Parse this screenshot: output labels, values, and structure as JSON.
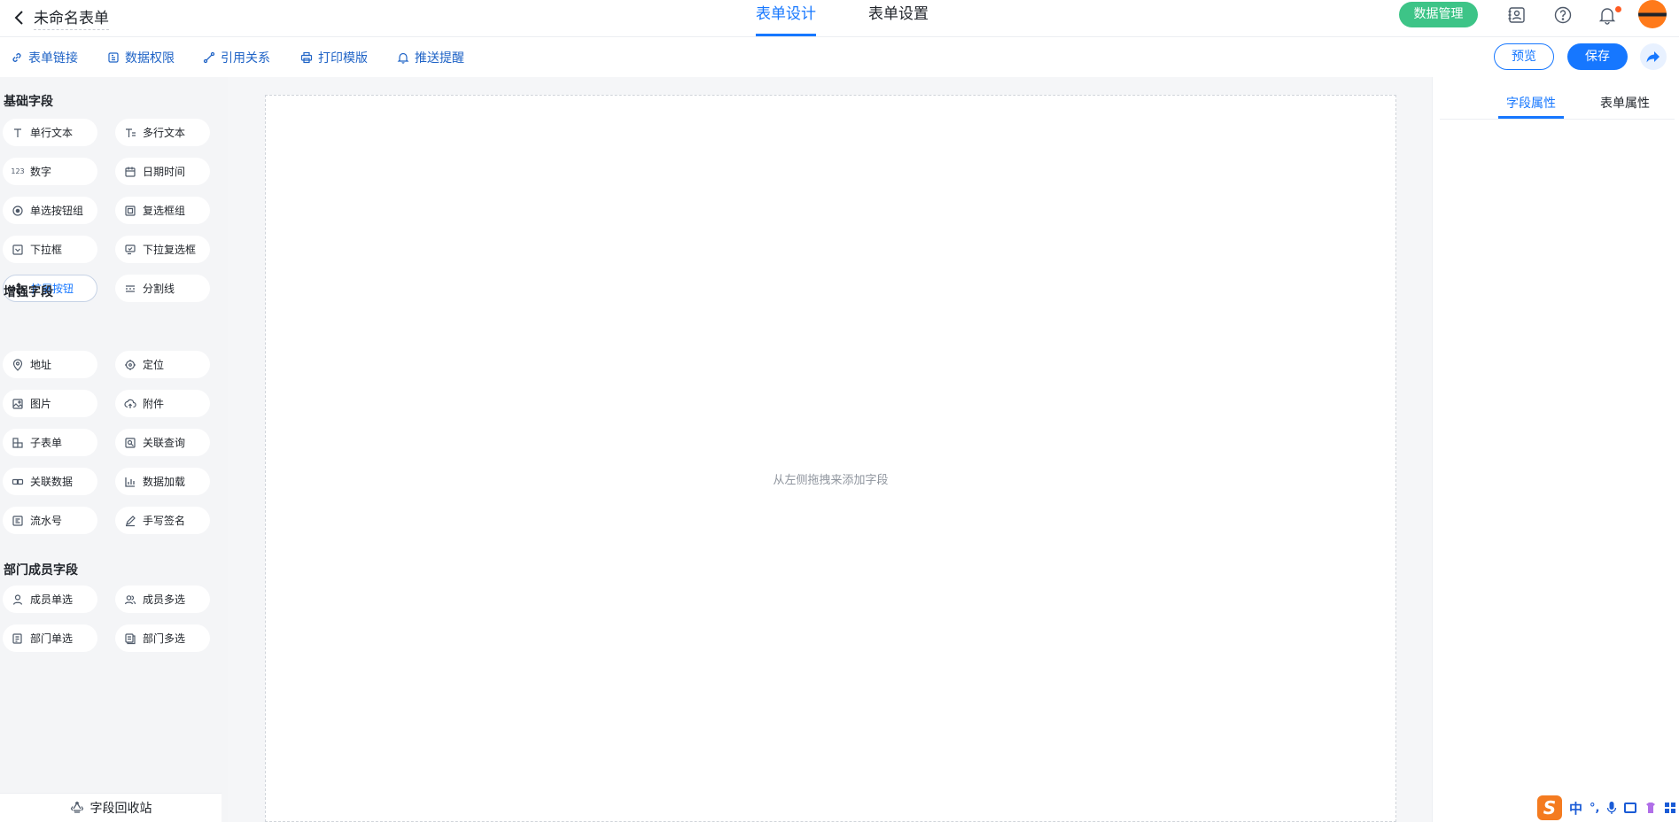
{
  "header": {
    "title": "未命名表单",
    "tabs": [
      {
        "label": "表单设计",
        "active": true
      },
      {
        "label": "表单设置",
        "active": false
      }
    ],
    "data_manage_label": "数据管理"
  },
  "toolbar": {
    "items": [
      {
        "label": "表单链接",
        "icon": "link-icon"
      },
      {
        "label": "数据权限",
        "icon": "permission-icon"
      },
      {
        "label": "引用关系",
        "icon": "relation-icon"
      },
      {
        "label": "打印模版",
        "icon": "print-icon"
      },
      {
        "label": "推送提醒",
        "icon": "bell-icon"
      }
    ],
    "preview_label": "预览",
    "save_label": "保存"
  },
  "sidebar": {
    "sections": [
      {
        "title": "基础字段",
        "fields": [
          {
            "label": "单行文本",
            "icon": "text-icon"
          },
          {
            "label": "多行文本",
            "icon": "multiline-text-icon"
          },
          {
            "label": "数字",
            "icon": "number-icon",
            "glyph": "123"
          },
          {
            "label": "日期时间",
            "icon": "calendar-icon"
          },
          {
            "label": "单选按钮组",
            "icon": "radio-icon"
          },
          {
            "label": "复选框组",
            "icon": "checkbox-icon"
          },
          {
            "label": "下拉框",
            "icon": "dropdown-icon"
          },
          {
            "label": "下拉复选框",
            "icon": "dropdown-checkbox-icon"
          },
          {
            "label": "扩展按钮",
            "icon": "move-icon"
          },
          {
            "label": "分割线",
            "icon": "divider-icon"
          }
        ]
      },
      {
        "title": "增强字段",
        "fields": [
          {
            "label": "地址",
            "icon": "location-pin-icon"
          },
          {
            "label": "定位",
            "icon": "crosshair-icon"
          },
          {
            "label": "图片",
            "icon": "image-icon"
          },
          {
            "label": "附件",
            "icon": "cloud-upload-icon"
          },
          {
            "label": "子表单",
            "icon": "subform-icon"
          },
          {
            "label": "关联查询",
            "icon": "lookup-icon"
          },
          {
            "label": "关联数据",
            "icon": "linked-data-icon"
          },
          {
            "label": "数据加载",
            "icon": "bar-chart-icon"
          },
          {
            "label": "流水号",
            "icon": "serial-number-icon"
          },
          {
            "label": "手写签名",
            "icon": "pen-icon"
          }
        ]
      },
      {
        "title": "部门成员字段",
        "fields": [
          {
            "label": "成员单选",
            "icon": "user-icon"
          },
          {
            "label": "成员多选",
            "icon": "users-icon"
          },
          {
            "label": "部门单选",
            "icon": "department-icon"
          },
          {
            "label": "部门多选",
            "icon": "departments-icon"
          }
        ]
      }
    ],
    "recycle_label": "字段回收站"
  },
  "canvas": {
    "hint": "从左侧拖拽来添加字段"
  },
  "right_panel": {
    "tabs": [
      {
        "label": "字段属性",
        "active": true
      },
      {
        "label": "表单属性",
        "active": false
      }
    ]
  },
  "ime": {
    "lang": "中",
    "punct": "°,"
  },
  "colors": {
    "accent": "#1677ff",
    "data_manage_bg": "#3dc487",
    "sidebar_bg": "#f4f5f7"
  }
}
